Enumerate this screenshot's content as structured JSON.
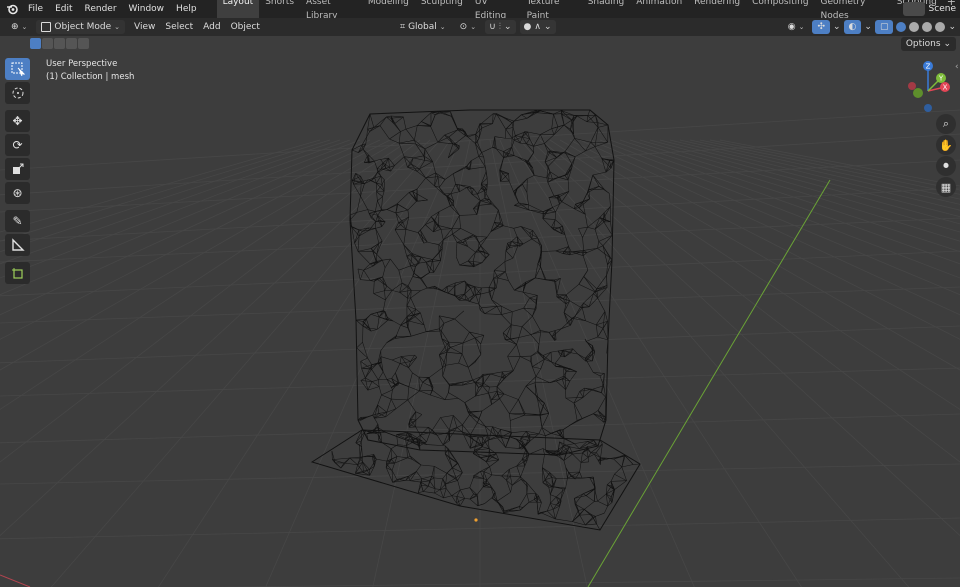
{
  "app": {
    "name": "Blender"
  },
  "menu": [
    "File",
    "Edit",
    "Render",
    "Window",
    "Help"
  ],
  "workspaces": [
    "Layout",
    "Shorts",
    "Asset Library",
    "Modeling",
    "Sculpting",
    "UV Editing",
    "Texture Paint",
    "Shading",
    "Animation",
    "Rendering",
    "Compositing",
    "Geometry Nodes",
    "Scripting"
  ],
  "active_workspace": "Layout",
  "scene": {
    "label": "Scene"
  },
  "header": {
    "mode": "Object Mode",
    "view": "View",
    "select": "Select",
    "add": "Add",
    "object": "Object",
    "transform_orientation": "Global",
    "options": "Options"
  },
  "viewport": {
    "perspective": "User Perspective",
    "collection": "(1) Collection | mesh"
  },
  "gizmo": {
    "axes": [
      "X",
      "Y",
      "Z"
    ]
  },
  "colors": {
    "accent": "#4d7fc4",
    "x_axis": "#e34656",
    "y_axis": "#7ebd3a",
    "z_axis": "#3a7bd8",
    "wire": "#111111",
    "bg": "#3d3d3d"
  },
  "icons": {
    "tools": [
      "select-box-icon",
      "cursor-icon",
      "move-icon",
      "rotate-icon",
      "scale-icon",
      "transform-icon",
      "annotate-icon",
      "measure-icon",
      "add-cube-icon"
    ],
    "nav": [
      "zoom-icon",
      "pan-hand-icon",
      "camera-icon",
      "grid-ortho-icon"
    ]
  }
}
